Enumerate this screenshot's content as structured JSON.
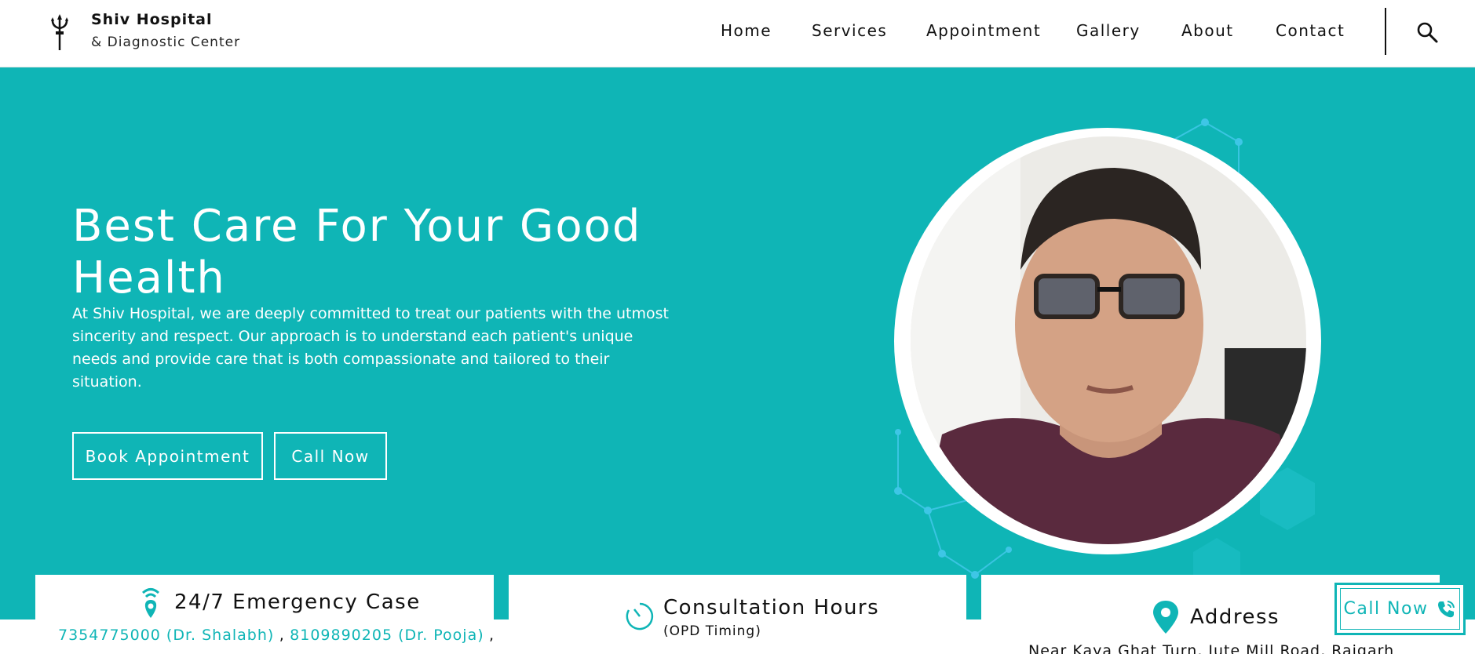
{
  "brand": {
    "name": "Shiv Hospital",
    "tagline": "& Diagnostic Center",
    "logo_icon": "trident-icon"
  },
  "nav": {
    "items": [
      {
        "label": "Home"
      },
      {
        "label": "Services"
      },
      {
        "label": "Appointment"
      },
      {
        "label": "Gallery"
      },
      {
        "label": "About"
      },
      {
        "label": "Contact"
      }
    ],
    "search_icon": "search-icon"
  },
  "hero": {
    "title": "Best Care For Your Good Health",
    "description": "At Shiv Hospital, we are deeply committed to treat our patients with the utmost sincerity and respect. Our approach is to understand each patient's unique needs and provide care that is both compassionate and tailored to their situation.",
    "book_label": "Book Appointment",
    "call_label": "Call Now",
    "portrait_icon": "doctor-portrait"
  },
  "cards": {
    "emergency": {
      "title": "24/7 Emergency Case",
      "icon": "location-signal-icon",
      "phone_1": "7354775000 (Dr. Shalabh)",
      "phone_2": "8109890205 (Dr. Pooja)",
      "separator": ",",
      "trailing": ","
    },
    "consultation": {
      "title": "Consultation Hours",
      "subtitle": "(OPD Timing)",
      "icon": "clock-icon"
    },
    "address": {
      "title": "Address",
      "line": "Near Kaya Ghat Turn, Jute Mill Road, Raigarh",
      "icon": "map-pin-icon"
    }
  },
  "floating_call": {
    "label": "Call Now",
    "icon": "phone-ringing-icon"
  },
  "colors": {
    "accent": "#0fb5b6",
    "header_bg": "#ffffff",
    "text": "#111111"
  }
}
